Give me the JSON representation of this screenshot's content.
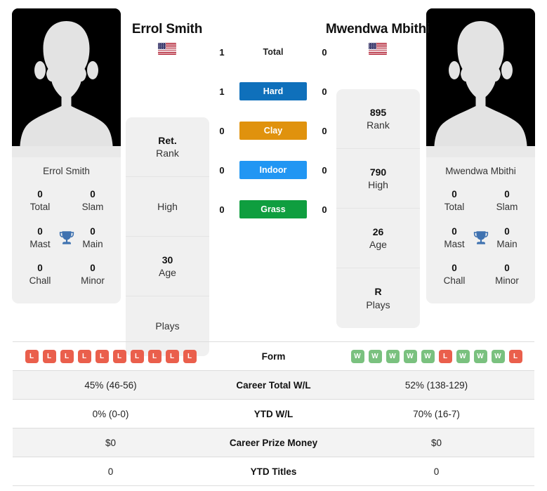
{
  "players": {
    "left": {
      "name": "Errol Smith",
      "card_name": "Errol Smith",
      "flag": "us-flag-icon",
      "titles": {
        "total_value": "0",
        "total_label": "Total",
        "slam_value": "0",
        "slam_label": "Slam",
        "mast_value": "0",
        "mast_label": "Mast",
        "main_value": "0",
        "main_label": "Main",
        "chall_value": "0",
        "chall_label": "Chall",
        "minor_value": "0",
        "minor_label": "Minor",
        "trophy_icon": "trophy-icon"
      },
      "stats": [
        {
          "value": "Ret.",
          "label": "Rank"
        },
        {
          "value": "",
          "label": "High"
        },
        {
          "value": "30",
          "label": "Age"
        },
        {
          "value": "",
          "label": "Plays"
        }
      ],
      "form": [
        "L",
        "L",
        "L",
        "L",
        "L",
        "L",
        "L",
        "L",
        "L",
        "L"
      ],
      "career_total_wl": "45% (46-56)",
      "ytd_wl": "0% (0-0)",
      "career_prize_money": "$0",
      "ytd_titles": "0"
    },
    "right": {
      "name": "Mwendwa Mbithi",
      "card_name": "Mwendwa Mbithi",
      "flag": "us-flag-icon",
      "titles": {
        "total_value": "0",
        "total_label": "Total",
        "slam_value": "0",
        "slam_label": "Slam",
        "mast_value": "0",
        "mast_label": "Mast",
        "main_value": "0",
        "main_label": "Main",
        "chall_value": "0",
        "chall_label": "Chall",
        "minor_value": "0",
        "minor_label": "Minor",
        "trophy_icon": "trophy-icon"
      },
      "stats": [
        {
          "value": "895",
          "label": "Rank"
        },
        {
          "value": "790",
          "label": "High"
        },
        {
          "value": "26",
          "label": "Age"
        },
        {
          "value": "R",
          "label": "Plays"
        }
      ],
      "form": [
        "W",
        "W",
        "W",
        "W",
        "W",
        "L",
        "W",
        "W",
        "W",
        "L"
      ],
      "career_total_wl": "52% (138-129)",
      "ytd_wl": "70% (16-7)",
      "career_prize_money": "$0",
      "ytd_titles": "0"
    }
  },
  "head_to_head": [
    {
      "label": "Total",
      "left": "1",
      "right": "0",
      "style": "plain",
      "color": ""
    },
    {
      "label": "Hard",
      "left": "1",
      "right": "0",
      "style": "badge",
      "color": "#0f70bb"
    },
    {
      "label": "Clay",
      "left": "0",
      "right": "0",
      "style": "badge",
      "color": "#e0920d"
    },
    {
      "label": "Indoor",
      "left": "0",
      "right": "0",
      "style": "badge",
      "color": "#2196f3"
    },
    {
      "label": "Grass",
      "left": "0",
      "right": "0",
      "style": "badge",
      "color": "#0f9e3f"
    }
  ],
  "table_rows": [
    {
      "label": "Form",
      "type": "form"
    },
    {
      "label": "Career Total W/L",
      "type": "text",
      "key": "career_total_wl"
    },
    {
      "label": "YTD W/L",
      "type": "text",
      "key": "ytd_wl"
    },
    {
      "label": "Career Prize Money",
      "type": "text",
      "key": "career_prize_money"
    },
    {
      "label": "YTD Titles",
      "type": "text",
      "key": "ytd_titles"
    }
  ],
  "colors": {
    "win_badge": "#7ac17f",
    "loss_badge": "#ea5f4c",
    "trophy": "#3f72b0",
    "card_bg": "#f0f0f0",
    "row_alt_bg": "#f3f3f3"
  }
}
